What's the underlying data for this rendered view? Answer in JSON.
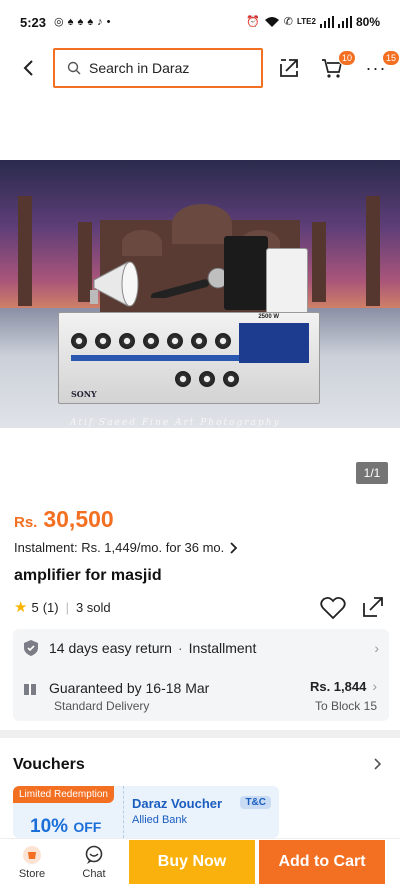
{
  "status_bar": {
    "time": "5:23",
    "battery": "80%",
    "network": "LTE2"
  },
  "search": {
    "placeholder": "Search in Daraz"
  },
  "header": {
    "cart_badge": "10",
    "more_badge": "15"
  },
  "gallery": {
    "pager": "1/1",
    "watermark": "Atif Saeed Fine Art Photography",
    "brand_on_device": "SONY",
    "power_label": "2500 W"
  },
  "product": {
    "currency": "Rs.",
    "price": "30,500",
    "instalment": "Instalment: Rs. 1,449/mo. for 36 mo.",
    "title": "amplifier for masjid",
    "rating": "5",
    "rating_count": "(1)",
    "sold": "3 sold"
  },
  "info": {
    "return_text": "14 days easy return",
    "installment_text": "Installment",
    "guaranteed": "Guaranteed by 16-18 Mar",
    "delivery_type": "Standard Delivery",
    "delivery_price": "Rs. 1,844",
    "delivery_to": "To Block 15"
  },
  "vouchers": {
    "heading": "Vouchers",
    "limited": "Limited Redemption",
    "discount": "10%",
    "discount_suffix": "OFF",
    "voucher_name": "Daraz Voucher",
    "bank": "Allied Bank",
    "tnc": "T&C"
  },
  "bottom_bar": {
    "store": "Store",
    "chat": "Chat",
    "buy_now": "Buy Now",
    "add_to_cart": "Add to Cart"
  },
  "colors": {
    "accent": "#f36f21",
    "buy_now": "#fbb10d",
    "voucher_blue": "#1a6fd9"
  }
}
